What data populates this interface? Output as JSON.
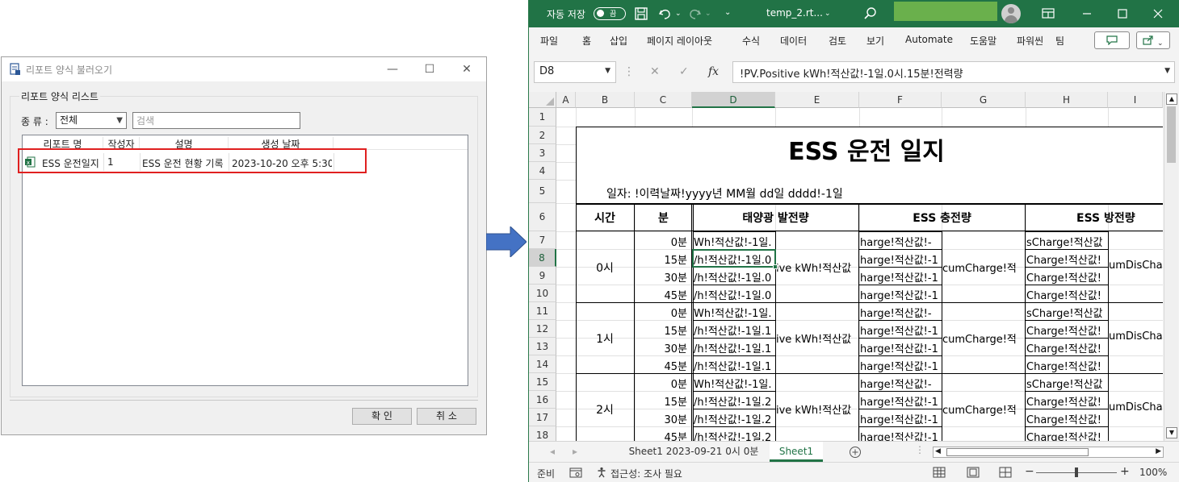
{
  "dialog": {
    "title": "리포트 양식 불러오기",
    "group_label": "리포트 양식 리스트",
    "type_label": "종 류 :",
    "type_selected": "전체",
    "search_placeholder": "검색",
    "columns": [
      "리포트 명",
      "작성자",
      "설명",
      "생성 날짜"
    ],
    "rows": [
      {
        "name": "ESS 운전일지",
        "author": "1",
        "description": "ESS 운전 현황 기록",
        "created": "2023-10-20 오후 5:30"
      }
    ],
    "ok_label": "확 인",
    "cancel_label": "취 소",
    "minimize_glyph": "—",
    "maximize_glyph": "☐",
    "close_glyph": "✕"
  },
  "excel": {
    "autosave_label": "자동 저장",
    "autosave_state": "끔",
    "filename": "temp_2.rt...",
    "menu": [
      "파일",
      "홈",
      "삽입",
      "페이지 레이아웃",
      "수식",
      "데이터",
      "검토",
      "보기",
      "Automate",
      "도움말",
      "파워씬",
      "팀"
    ],
    "namebox": "D8",
    "formula": "!PV.Positive kWh!적산값!-1일.0시.15분!전력량",
    "fx_label": "fx",
    "columns": [
      "A",
      "B",
      "C",
      "D",
      "E",
      "F",
      "G",
      "H",
      "I"
    ],
    "rows": [
      "1",
      "2",
      "3",
      "4",
      "5",
      "6",
      "7",
      "8",
      "9",
      "10",
      "11",
      "12",
      "13",
      "14",
      "15",
      "16",
      "17",
      "18"
    ],
    "sheet": {
      "title": "ESS 운전 일지",
      "date_line": "일자: !이력날짜!yyyy년 MM월 dd일 dddd!-1일",
      "headers": [
        "시간",
        "분",
        "태양광 발전량",
        "ESS 충전량",
        "ESS 방전량"
      ],
      "hours": [
        "0시",
        "1시",
        "2시"
      ],
      "minutes": [
        "0분",
        "15분",
        "30분",
        "45분"
      ],
      "pv_rows": [
        "Wh!적산값!-1일.",
        "/h!적산값!-1일.0",
        "/h!적산값!-1일.0",
        "/h!적산값!-1일.0",
        "Wh!적산값!-1일.",
        "/h!적산값!-1일.1",
        "/h!적산값!-1일.1",
        "/h!적산값!-1일.1",
        "Wh!적산값!-1일.",
        "/h!적산값!-1일.2",
        "/h!적산값!-1일.2",
        "/h!적산값!-1일.2"
      ],
      "pv_total": "ive kWh!적산값",
      "charge_rows": [
        "harge!적산값!-",
        "harge!적산값!-1",
        "harge!적산값!-1",
        "harge!적산값!-1",
        "harge!적산값!-",
        "harge!적산값!-1",
        "harge!적산값!-1",
        "harge!적산값!-1",
        "harge!적산값!-",
        "harge!적산값!-1",
        "harge!적산값!-1",
        "harge!적산값!-1"
      ],
      "charge_total": "cumCharge!적",
      "discharge_rows": [
        "sCharge!적산값",
        "Charge!적산값!",
        "Charge!적산값!",
        "Charge!적산값!",
        "sCharge!적산값",
        "Charge!적산값!",
        "Charge!적산값!",
        "Charge!적산값!",
        "sCharge!적산값",
        "Charge!적산값!",
        "Charge!적산값!",
        "Charge!적산값!"
      ],
      "discharge_total": "umDisCha"
    },
    "tabs": [
      "Sheet1 2023-09-21 0시 0분",
      "Sheet1"
    ],
    "active_tab": "Sheet1",
    "status_ready": "준비",
    "accessibility": "접근성: 조사 필요",
    "zoom": "100%",
    "colors": {
      "brand": "#217346",
      "account": "#6ab04c",
      "highlight": "#e02020",
      "arrow": "#4472c4"
    }
  }
}
